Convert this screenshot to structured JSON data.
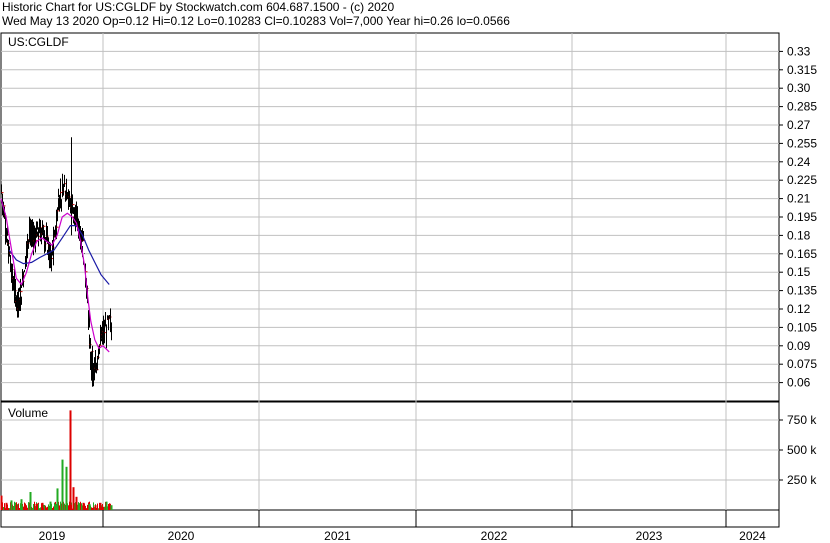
{
  "header": {
    "title_line": "Historic Chart for US:CGLDF by Stockwatch.com 604.687.1500 - (c) 2020",
    "stats_line": "Wed May 13 2020  Op=0.12  Hi=0.12  Lo=0.10283  Cl=0.10283  Vol=7,000  Year hi=0.26  lo=0.0566"
  },
  "price_panel": {
    "symbol_label": "US:CGLDF",
    "ticks": [
      "0.33",
      "0.315",
      "0.30",
      "0.285",
      "0.27",
      "0.255",
      "0.24",
      "0.225",
      "0.21",
      "0.195",
      "0.18",
      "0.165",
      "0.15",
      "0.135",
      "0.12",
      "0.105",
      "0.09",
      "0.075",
      "0.06"
    ]
  },
  "volume_panel": {
    "label": "Volume",
    "ticks": [
      "750 k",
      "500 k",
      "250 k"
    ]
  },
  "years": [
    "2019",
    "2020",
    "2021",
    "2022",
    "2023",
    "2024"
  ],
  "colors": {
    "price_bar": "#000000",
    "ma_short": "#cc00cc",
    "ma_long": "#1a1aa6",
    "vol_up": "#22aa22",
    "vol_down": "#dd0000",
    "grid": "#c0c0c0"
  },
  "chart_data": [
    {
      "type": "line",
      "name": "price",
      "x_unit": "year",
      "ylim": [
        0.045,
        0.345
      ],
      "ticks": [
        0.33,
        0.315,
        0.3,
        0.285,
        0.27,
        0.255,
        0.24,
        0.225,
        0.21,
        0.195,
        0.18,
        0.165,
        0.15,
        0.135,
        0.12,
        0.105,
        0.09,
        0.075,
        0.06
      ],
      "price_anchors": [
        [
          2019.0,
          0.215
        ],
        [
          2019.04,
          0.19
        ],
        [
          2019.08,
          0.16
        ],
        [
          2019.12,
          0.14
        ],
        [
          2019.16,
          0.125
        ],
        [
          2019.2,
          0.135
        ],
        [
          2019.24,
          0.165
        ],
        [
          2019.28,
          0.185
        ],
        [
          2019.32,
          0.175
        ],
        [
          2019.36,
          0.18
        ],
        [
          2019.4,
          0.185
        ],
        [
          2019.44,
          0.175
        ],
        [
          2019.48,
          0.16
        ],
        [
          2019.52,
          0.175
        ],
        [
          2019.56,
          0.21
        ],
        [
          2019.6,
          0.215
        ],
        [
          2019.64,
          0.22
        ],
        [
          2019.68,
          0.205
        ],
        [
          2019.72,
          0.195
        ],
        [
          2019.75,
          0.19
        ],
        [
          2019.8,
          0.175
        ],
        [
          2019.84,
          0.13
        ],
        [
          2019.87,
          0.09
        ],
        [
          2019.9,
          0.065
        ],
        [
          2019.93,
          0.075
        ],
        [
          2019.96,
          0.09
        ],
        [
          2020.0,
          0.1
        ],
        [
          2020.04,
          0.11
        ],
        [
          2020.05,
          0.103
        ]
      ],
      "ma_short": [
        [
          2019.0,
          0.21
        ],
        [
          2019.05,
          0.195
        ],
        [
          2019.1,
          0.17
        ],
        [
          2019.15,
          0.145
        ],
        [
          2019.2,
          0.14
        ],
        [
          2019.25,
          0.15
        ],
        [
          2019.3,
          0.165
        ],
        [
          2019.35,
          0.175
        ],
        [
          2019.4,
          0.178
        ],
        [
          2019.45,
          0.175
        ],
        [
          2019.5,
          0.172
        ],
        [
          2019.55,
          0.18
        ],
        [
          2019.6,
          0.195
        ],
        [
          2019.65,
          0.198
        ],
        [
          2019.7,
          0.195
        ],
        [
          2019.74,
          0.19
        ],
        [
          2019.78,
          0.175
        ],
        [
          2019.82,
          0.155
        ],
        [
          2019.85,
          0.13
        ],
        [
          2019.88,
          0.11
        ],
        [
          2019.92,
          0.095
        ],
        [
          2019.96,
          0.088
        ],
        [
          2020.0,
          0.09
        ],
        [
          2020.04,
          0.085
        ]
      ],
      "ma_long": [
        [
          2019.08,
          0.168
        ],
        [
          2019.15,
          0.16
        ],
        [
          2019.22,
          0.157
        ],
        [
          2019.3,
          0.158
        ],
        [
          2019.38,
          0.162
        ],
        [
          2019.45,
          0.165
        ],
        [
          2019.52,
          0.168
        ],
        [
          2019.6,
          0.178
        ],
        [
          2019.68,
          0.188
        ],
        [
          2019.74,
          0.188
        ],
        [
          2019.8,
          0.18
        ],
        [
          2019.86,
          0.168
        ],
        [
          2019.92,
          0.158
        ],
        [
          2019.98,
          0.148
        ],
        [
          2020.04,
          0.14
        ]
      ]
    },
    {
      "type": "bar",
      "name": "volume",
      "x_unit": "year",
      "ylim": [
        0,
        900000
      ],
      "ticks": [
        750000,
        500000,
        250000
      ],
      "spikes": [
        [
          2019.0,
          120000,
          "down"
        ],
        [
          2019.05,
          60000,
          "down"
        ],
        [
          2019.1,
          80000,
          "up"
        ],
        [
          2019.15,
          40000,
          "down"
        ],
        [
          2019.2,
          90000,
          "up"
        ],
        [
          2019.28,
          150000,
          "up"
        ],
        [
          2019.34,
          50000,
          "down"
        ],
        [
          2019.4,
          60000,
          "down"
        ],
        [
          2019.48,
          70000,
          "up"
        ],
        [
          2019.55,
          180000,
          "up"
        ],
        [
          2019.6,
          420000,
          "up"
        ],
        [
          2019.64,
          360000,
          "up"
        ],
        [
          2019.68,
          830000,
          "down"
        ],
        [
          2019.71,
          190000,
          "down"
        ],
        [
          2019.74,
          110000,
          "down"
        ],
        [
          2019.8,
          60000,
          "down"
        ],
        [
          2019.86,
          50000,
          "up"
        ],
        [
          2019.92,
          40000,
          "down"
        ],
        [
          2019.97,
          60000,
          "down"
        ],
        [
          2020.02,
          70000,
          "up"
        ],
        [
          2020.05,
          40000,
          "up"
        ]
      ]
    }
  ]
}
